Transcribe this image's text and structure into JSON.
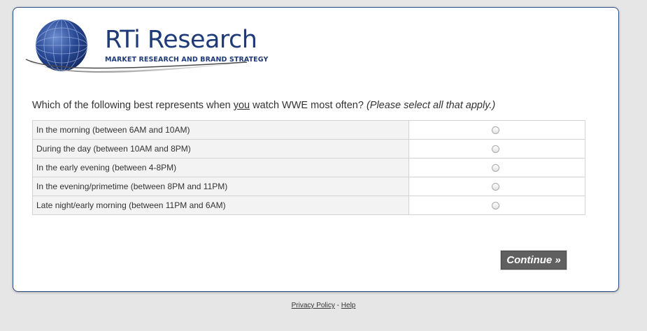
{
  "brand": {
    "name": "RTi Research",
    "tagline": "MARKET RESEARCH AND BRAND STRATEGY"
  },
  "question": {
    "prefix": "Which of the following best represents when ",
    "emphasis": "you",
    "suffix": " watch WWE most often? ",
    "note": "(Please select all that apply.)"
  },
  "options": [
    {
      "label": "In the morning (between 6AM and 10AM)",
      "selected": false
    },
    {
      "label": "During the day (between 10AM and 8PM)",
      "selected": false
    },
    {
      "label": "In the early evening (between 4-8PM)",
      "selected": false
    },
    {
      "label": "In the evening/primetime (between 8PM and 11PM)",
      "selected": false
    },
    {
      "label": "Late night/early morning (between 11PM and 6AM)",
      "selected": false
    }
  ],
  "continue_label": "Continue »",
  "footer": {
    "privacy": "Privacy Policy",
    "separator": " - ",
    "help": "Help"
  },
  "colors": {
    "brand_blue": "#1e3a78",
    "button_bg": "#606060",
    "page_bg": "#e6e6e6"
  }
}
